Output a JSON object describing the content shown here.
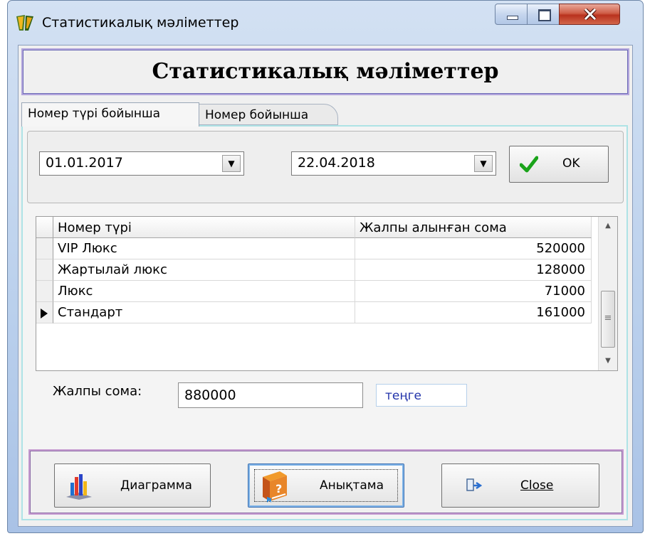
{
  "window": {
    "title": "Статистикалық мәліметтер"
  },
  "header": {
    "title": "Статистикалық мәліметтер"
  },
  "tabs": [
    {
      "label": "Номер түрі бойынша",
      "active": true
    },
    {
      "label": "Номер бойынша",
      "active": false
    }
  ],
  "filter": {
    "date_from": "01.01.2017",
    "date_to": "22.04.2018",
    "ok_label": "OK"
  },
  "grid": {
    "columns": [
      "Номер түрі",
      "Жалпы алынған сома"
    ],
    "rows": [
      {
        "type": "VIP Люкс",
        "sum": "520000",
        "current": false
      },
      {
        "type": "Жартылай люкс",
        "sum": "128000",
        "current": false
      },
      {
        "type": "Люкс",
        "sum": "71000",
        "current": false
      },
      {
        "type": "Стандарт",
        "sum": "161000",
        "current": true
      }
    ]
  },
  "total": {
    "label": "Жалпы сома:",
    "value": "880000",
    "currency": "теңге"
  },
  "buttons": {
    "diagram": "Диаграмма",
    "help": "Анықтама",
    "close": "Close"
  },
  "colors": {
    "ok_check": "#1aa31a",
    "currency_text": "#2233aa",
    "header_border": "#b2a4dc",
    "button_panel_border": "#c59ad0",
    "tabpage_border": "#aee3e6",
    "close_button": "#c8422b"
  },
  "icons": {
    "app": "app-logo-icon",
    "ok": "checkmark-icon",
    "diagram": "bar-chart-icon",
    "help": "help-book-icon",
    "close": "exit-door-icon"
  }
}
